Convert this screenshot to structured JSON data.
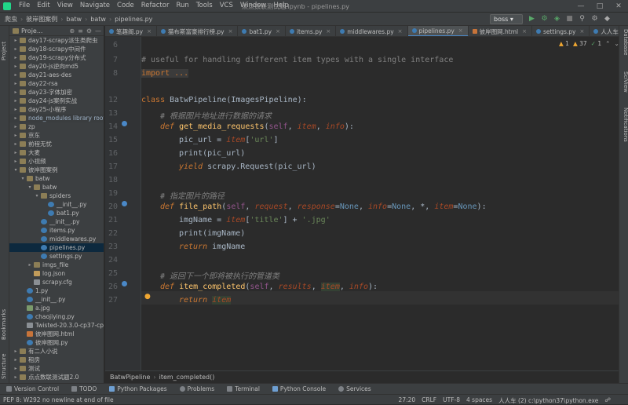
{
  "menu": [
    "File",
    "Edit",
    "View",
    "Navigate",
    "Code",
    "Refactor",
    "Run",
    "Tools",
    "VCS",
    "Window",
    "Help"
  ],
  "window_title": "点点数联测试题.ipynb - pipelines.py",
  "breadcrumb": [
    "爬虫",
    "彼岸图案例",
    "batw",
    "batw",
    "pipelines.py"
  ],
  "run_config": "boss",
  "project_label": "Proje...",
  "left_tabs": {
    "project": "Project",
    "bookmarks": "Bookmarks",
    "structure": "Structure"
  },
  "right_tabs": {
    "database": "Database",
    "sciview": "SciView",
    "notifications": "Notifications"
  },
  "tree": [
    {
      "label": "day17-scrapy派生类爬虫",
      "icon": "folder",
      "arrow": ">",
      "indent": 0
    },
    {
      "label": "day18-scrapy中间件",
      "icon": "folder",
      "arrow": ">",
      "indent": 0
    },
    {
      "label": "day19-scrapy分布式",
      "icon": "folder",
      "arrow": ">",
      "indent": 0
    },
    {
      "label": "day20-js逆向md5",
      "icon": "folder",
      "arrow": ">",
      "indent": 0
    },
    {
      "label": "day21-aes-des",
      "icon": "folder",
      "arrow": ">",
      "indent": 0
    },
    {
      "label": "day22-rsa",
      "icon": "folder",
      "arrow": ">",
      "indent": 0
    },
    {
      "label": "day23-字体加密",
      "icon": "folder",
      "arrow": ">",
      "indent": 0
    },
    {
      "label": "day24-js案例实战",
      "icon": "folder",
      "arrow": ">",
      "indent": 0
    },
    {
      "label": "day25-小程序",
      "icon": "folder",
      "arrow": ">",
      "indent": 0
    },
    {
      "label": "node_modules  library root",
      "icon": "folder",
      "arrow": ">",
      "indent": 0,
      "hl": true
    },
    {
      "label": "zp",
      "icon": "folder",
      "arrow": ">",
      "indent": 0
    },
    {
      "label": "京东",
      "icon": "folder",
      "arrow": ">",
      "indent": 0
    },
    {
      "label": "前程无忧",
      "icon": "folder",
      "arrow": ">",
      "indent": 0
    },
    {
      "label": "大麦",
      "icon": "folder",
      "arrow": ">",
      "indent": 0
    },
    {
      "label": "小视频",
      "icon": "folder",
      "arrow": ">",
      "indent": 0
    },
    {
      "label": "彼岸图案例",
      "icon": "folder",
      "arrow": "v",
      "indent": 0
    },
    {
      "label": "batw",
      "icon": "folder",
      "arrow": "v",
      "indent": 1
    },
    {
      "label": "batw",
      "icon": "folder",
      "arrow": "v",
      "indent": 2
    },
    {
      "label": "spiders",
      "icon": "folder",
      "arrow": "v",
      "indent": 3
    },
    {
      "label": "__init__.py",
      "icon": "py",
      "arrow": "",
      "indent": 4
    },
    {
      "label": "bat1.py",
      "icon": "py",
      "arrow": "",
      "indent": 4
    },
    {
      "label": "__init__.py",
      "icon": "py",
      "arrow": "",
      "indent": 3
    },
    {
      "label": "items.py",
      "icon": "py",
      "arrow": "",
      "indent": 3
    },
    {
      "label": "middlewares.py",
      "icon": "py",
      "arrow": "",
      "indent": 3
    },
    {
      "label": "pipelines.py",
      "icon": "py",
      "arrow": "",
      "indent": 3,
      "selected": true
    },
    {
      "label": "settings.py",
      "icon": "py",
      "arrow": "",
      "indent": 3
    },
    {
      "label": "imgs_file",
      "icon": "folder",
      "arrow": ">",
      "indent": 2
    },
    {
      "label": "log.json",
      "icon": "json",
      "arrow": "",
      "indent": 2
    },
    {
      "label": "scrapy.cfg",
      "icon": "file",
      "arrow": "",
      "indent": 2
    },
    {
      "label": "1.py",
      "icon": "py",
      "arrow": "",
      "indent": 1
    },
    {
      "label": "__init__.py",
      "icon": "py",
      "arrow": "",
      "indent": 1
    },
    {
      "label": "a.jpg",
      "icon": "jpg",
      "arrow": "",
      "indent": 1
    },
    {
      "label": "chaojiying.py",
      "icon": "py",
      "arrow": "",
      "indent": 1
    },
    {
      "label": "Twisted-20.3.0-cp37-cp",
      "icon": "file",
      "arrow": "",
      "indent": 1
    },
    {
      "label": "彼岸图网.html",
      "icon": "html",
      "arrow": "",
      "indent": 1
    },
    {
      "label": "彼岸图网.py",
      "icon": "py",
      "arrow": "",
      "indent": 1
    },
    {
      "label": "有二人小说",
      "icon": "folder",
      "arrow": ">",
      "indent": 0
    },
    {
      "label": "租房",
      "icon": "folder",
      "arrow": ">",
      "indent": 0
    },
    {
      "label": "测试",
      "icon": "folder",
      "arrow": ">",
      "indent": 0
    },
    {
      "label": "点点数联测试题2.0",
      "icon": "folder",
      "arrow": ">",
      "indent": 0
    }
  ],
  "tabs": [
    {
      "label": "笔趣阁.py",
      "icon": "py"
    },
    {
      "label": "猫布斯富豪排行榜.py",
      "icon": "py"
    },
    {
      "label": "bat1.py",
      "icon": "py"
    },
    {
      "label": "items.py",
      "icon": "py"
    },
    {
      "label": "middlewares.py",
      "icon": "py"
    },
    {
      "label": "pipelines.py",
      "icon": "py",
      "active": true
    },
    {
      "label": "彼岸图网.html",
      "icon": "html"
    },
    {
      "label": "settings.py",
      "icon": "py"
    },
    {
      "label": "人人车-批量.py",
      "icon": "py"
    }
  ],
  "inspections": {
    "weak_warnings": "1",
    "warnings": "37",
    "typos": "1"
  },
  "code_lines": [
    {
      "n": "6"
    },
    {
      "n": "7"
    },
    {
      "n": "8"
    },
    {
      "n": "12"
    },
    {
      "n": "13"
    },
    {
      "n": "14"
    },
    {
      "n": "15"
    },
    {
      "n": "16"
    },
    {
      "n": "17"
    },
    {
      "n": "18"
    },
    {
      "n": "19"
    },
    {
      "n": "20"
    },
    {
      "n": "21"
    },
    {
      "n": "22"
    },
    {
      "n": "23"
    },
    {
      "n": "24"
    },
    {
      "n": "25"
    },
    {
      "n": "26"
    },
    {
      "n": "27"
    }
  ],
  "code": {
    "l7": "# useful for handling different item types with a single interface",
    "l8": "import ...",
    "l12_kw": "class ",
    "l12_name": "BatwPipeline",
    "l12_rest": "(ImagesPipeline):",
    "l13": "# 根据图片地址进行数据的请求",
    "l14_def": "def ",
    "l14_fn": "get_media_requests",
    "l14_p1": "(",
    "l14_self": "self",
    "l14_c1": ", ",
    "l14_item": "item",
    "l14_c2": ", ",
    "l14_info": "info",
    "l14_end": "):",
    "l15_a": "pic_url = ",
    "l15_item": "item",
    "l15_b": "[",
    "l15_str": "'url'",
    "l15_c": "]",
    "l16": "print(pic_url)",
    "l17_kw": "yield ",
    "l17_rest": "scrapy.Request(pic_url)",
    "l19": "# 指定图片的路径",
    "l20_def": "def ",
    "l20_fn": "file_path",
    "l20_p": "(",
    "l20_self": "self",
    "l20_c": ", ",
    "l20_req": "request",
    "l20_c2": ", ",
    "l20_resp": "response",
    "l20_eq1": "=",
    "l20_none1": "None",
    "l20_c3": ", ",
    "l20_info": "info",
    "l20_eq2": "=",
    "l20_none2": "None",
    "l20_c4": ", *, ",
    "l20_item": "item",
    "l20_eq3": "=",
    "l20_none3": "None",
    "l20_end": "):",
    "l21_a": "imgName = ",
    "l21_item": "item",
    "l21_b": "[",
    "l21_s1": "'title'",
    "l21_c": "] + ",
    "l21_s2": "'.jpg'",
    "l22": "print(imgName)",
    "l23_kw": "return ",
    "l23_rest": "imgName",
    "l25": "# 返回下一个即将被执行的管道类",
    "l26_def": "def ",
    "l26_fn": "item_completed",
    "l26_p": "(",
    "l26_self": "self",
    "l26_c": ", ",
    "l26_results": "results",
    "l26_c2": ", ",
    "l26_item": "item",
    "l26_c3": ", ",
    "l26_info": "info",
    "l26_end": "):",
    "l27_kw": "return ",
    "l27_item": "item"
  },
  "bottom_breadcrumb": [
    "BatwPipeline",
    "item_completed()"
  ],
  "toolwindows": [
    "Version Control",
    "TODO",
    "Python Packages",
    "Problems",
    "Terminal",
    "Python Console",
    "Services"
  ],
  "status": {
    "message": "PEP 8: W292 no newline at end of file",
    "position": "27:20",
    "line_sep": "CRLF",
    "encoding": "UTF-8",
    "indent": "4 spaces",
    "interpreter": "人人车 (2)  c:\\python37\\python.exe"
  }
}
